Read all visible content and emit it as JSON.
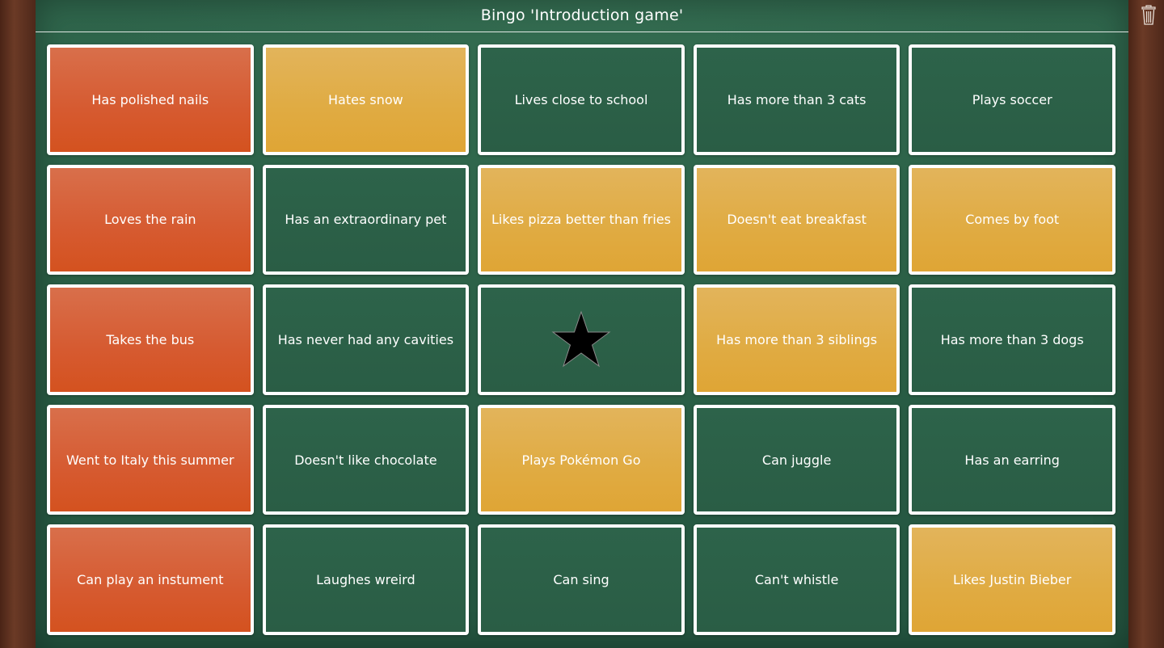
{
  "header": {
    "title": "Bingo 'Introduction game'",
    "trash_icon": "trash-icon"
  },
  "colors": {
    "red": "#d65a30",
    "yellow": "#e0ab42",
    "green": "#2a5d45",
    "border": "#ffffff"
  },
  "grid": {
    "rows": 5,
    "columns": 5,
    "cells": [
      {
        "label": "Has polished nails",
        "state": "red"
      },
      {
        "label": "Hates snow",
        "state": "yellow"
      },
      {
        "label": "Lives close to school",
        "state": "green"
      },
      {
        "label": "Has more than 3 cats",
        "state": "green"
      },
      {
        "label": "Plays soccer",
        "state": "green"
      },
      {
        "label": "Loves the rain",
        "state": "red"
      },
      {
        "label": "Has an extraordinary pet",
        "state": "green"
      },
      {
        "label": "Likes pizza better than fries",
        "state": "yellow"
      },
      {
        "label": "Doesn't eat breakfast",
        "state": "yellow"
      },
      {
        "label": "Comes by foot",
        "state": "yellow"
      },
      {
        "label": "Takes the bus",
        "state": "red"
      },
      {
        "label": "Has never had any cavities",
        "state": "green"
      },
      {
        "label": "",
        "state": "green",
        "icon": "star-icon",
        "free": true
      },
      {
        "label": "Has more than 3 siblings",
        "state": "yellow"
      },
      {
        "label": "Has more than 3 dogs",
        "state": "green"
      },
      {
        "label": "Went to Italy this summer",
        "state": "red"
      },
      {
        "label": "Doesn't like chocolate",
        "state": "green"
      },
      {
        "label": "Plays Pokémon Go",
        "state": "yellow"
      },
      {
        "label": "Can juggle",
        "state": "green"
      },
      {
        "label": "Has an earring",
        "state": "green"
      },
      {
        "label": "Can play an instument",
        "state": "red"
      },
      {
        "label": "Laughes wreird",
        "state": "green"
      },
      {
        "label": "Can sing",
        "state": "green"
      },
      {
        "label": "Can't whistle",
        "state": "green"
      },
      {
        "label": "Likes Justin Bieber",
        "state": "yellow"
      }
    ]
  }
}
